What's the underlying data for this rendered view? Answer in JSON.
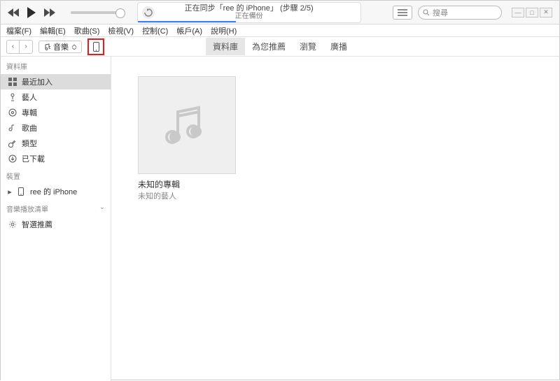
{
  "lcd": {
    "title": "正在同步「ree 的 iPhone」 (步驟 2/5)",
    "subtitle": "正在備份"
  },
  "search_placeholder": "搜尋",
  "menu": [
    "檔案(F)",
    "編輯(E)",
    "歌曲(S)",
    "檢視(V)",
    "控制(C)",
    "帳戶(A)",
    "說明(H)"
  ],
  "media_selector": "音樂",
  "tabs": [
    "資料庫",
    "為您推薦",
    "瀏覽",
    "廣播"
  ],
  "sidebar": {
    "library_header": "資料庫",
    "library_items": [
      "最近加入",
      "藝人",
      "專輯",
      "歌曲",
      "類型",
      "已下載"
    ],
    "device_header": "裝置",
    "device_name": "ree 的 iPhone",
    "playlist_header": "音樂播放清單",
    "playlist_item": "智選推薦"
  },
  "album": {
    "title": "未知的專輯",
    "artist": "未知的藝人"
  }
}
